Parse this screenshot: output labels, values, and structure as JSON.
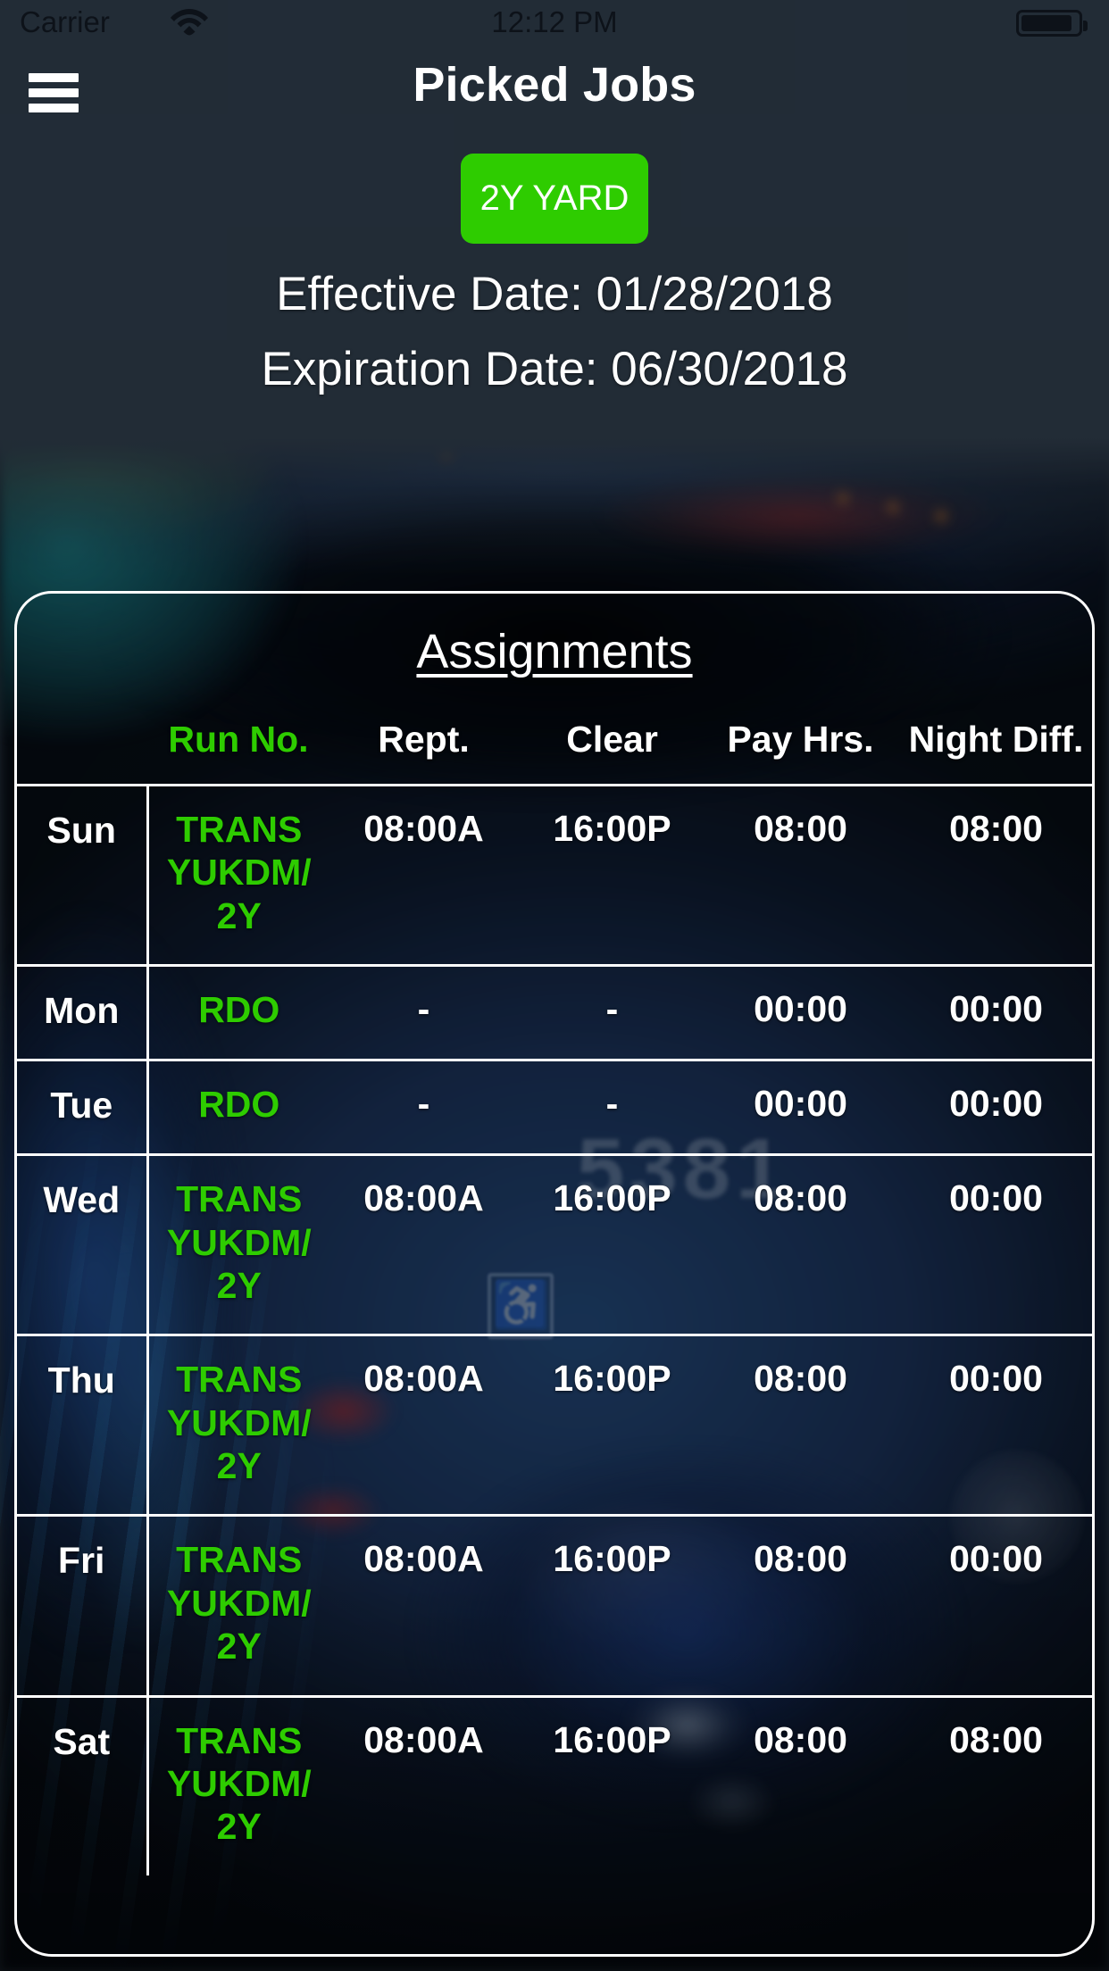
{
  "status_bar": {
    "carrier": "Carrier",
    "wifi_icon": "wifi-icon",
    "time": "12:12 PM",
    "battery_icon": "battery-icon"
  },
  "nav_bar": {
    "menu_icon": "hamburger-menu-icon",
    "title": "Picked Jobs"
  },
  "yard": {
    "button_label": "2Y YARD",
    "button_color": "#2ecc00"
  },
  "dates": {
    "effective": "Effective Date: 01/28/2018",
    "expiration": "Expiration Date: 06/30/2018"
  },
  "assignments": {
    "title": "Assignments",
    "columns": [
      "",
      "Run No.",
      "Rept.",
      "Clear",
      "Pay Hrs.",
      "Night Diff."
    ],
    "accent_color": "#2ecc00",
    "rows": [
      {
        "day": "Sun",
        "run": "TRANS YUKDM/ 2Y",
        "rept": "08:00A",
        "clear": "16:00P",
        "pay_hrs": "08:00",
        "night_diff": "08:00"
      },
      {
        "day": "Mon",
        "run": "RDO",
        "rept": "-",
        "clear": "-",
        "pay_hrs": "00:00",
        "night_diff": "00:00"
      },
      {
        "day": "Tue",
        "run": "RDO",
        "rept": "-",
        "clear": "-",
        "pay_hrs": "00:00",
        "night_diff": "00:00"
      },
      {
        "day": "Wed",
        "run": "TRANS YUKDM/ 2Y",
        "rept": "08:00A",
        "clear": "16:00P",
        "pay_hrs": "08:00",
        "night_diff": "00:00"
      },
      {
        "day": "Thu",
        "run": "TRANS YUKDM/ 2Y",
        "rept": "08:00A",
        "clear": "16:00P",
        "pay_hrs": "08:00",
        "night_diff": "00:00"
      },
      {
        "day": "Fri",
        "run": "TRANS YUKDM/ 2Y",
        "rept": "08:00A",
        "clear": "16:00P",
        "pay_hrs": "08:00",
        "night_diff": "00:00"
      },
      {
        "day": "Sat",
        "run": "TRANS YUKDM/ 2Y",
        "rept": "08:00A",
        "clear": "16:00P",
        "pay_hrs": "08:00",
        "night_diff": "08:00"
      }
    ]
  },
  "background": {
    "photo_description": "blurred MTA bus",
    "bus_number": "5381"
  }
}
